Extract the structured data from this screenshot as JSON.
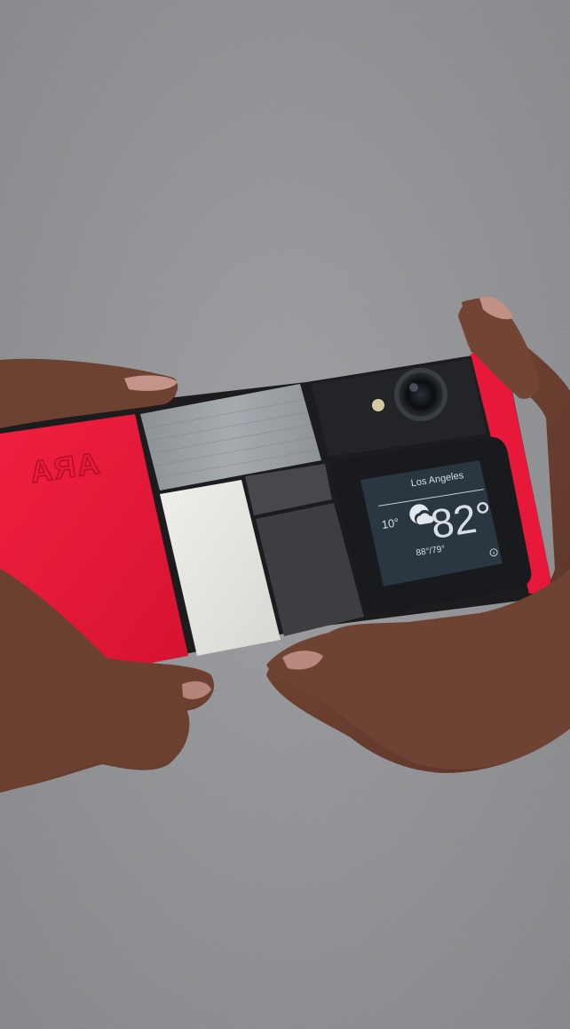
{
  "photo": {
    "background_color": "#8b8c8e",
    "phone_frame_color": "#1c1c1f",
    "phone_accent_color": "#e8183a",
    "skin_color": "#6d4233"
  },
  "phone": {
    "logo_text": "ARA",
    "camera_icon": "camera-lens-icon",
    "flash_icon": "flash-led-icon"
  },
  "weather_widget": {
    "city": "Los Angeles",
    "temperature": "82°",
    "high_low": "88°/79°",
    "secondary_temp": "10°",
    "weather_icon": "partly-cloudy-icon",
    "info_icon": "info-icon"
  }
}
